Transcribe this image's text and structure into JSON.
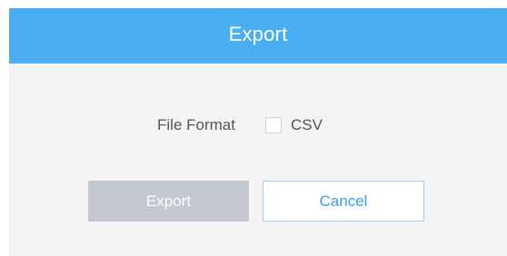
{
  "dialog": {
    "title": "Export",
    "file_format_label": "File Format",
    "format_option": {
      "label": "CSV",
      "checked": false
    },
    "export_button_label": "Export",
    "cancel_button_label": "Cancel"
  },
  "colors": {
    "header_bg": "#4aaff2",
    "export_button_disabled": "#c4c8d0",
    "cancel_text": "#3a9ee8"
  },
  "icons": {
    "checkbox": "checkbox-unchecked"
  }
}
